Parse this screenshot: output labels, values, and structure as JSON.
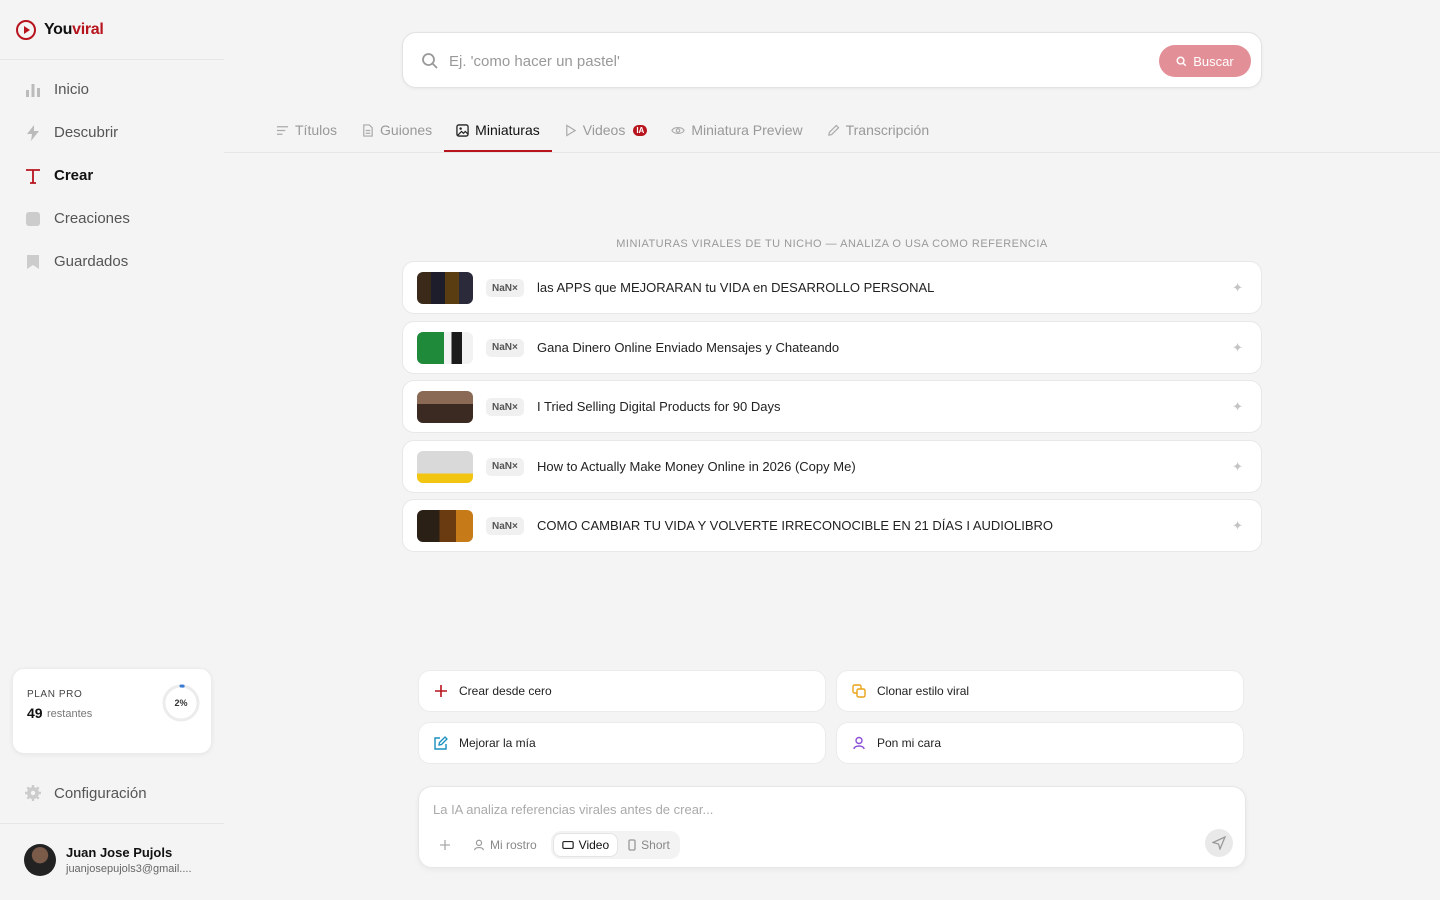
{
  "app": {
    "name_a": "You",
    "name_b": "viral"
  },
  "sidebar": {
    "items": [
      {
        "label": "Inicio",
        "icon": "bar-chart-icon"
      },
      {
        "label": "Descubrir",
        "icon": "lightning-icon"
      },
      {
        "label": "Crear",
        "icon": "text-cursor-icon"
      },
      {
        "label": "Creaciones",
        "icon": "folder-icon"
      },
      {
        "label": "Guardados",
        "icon": "bookmark-icon"
      }
    ],
    "active_index": 2,
    "plan": {
      "label": "PLAN PRO",
      "count": "49",
      "count_label": "restantes",
      "percent_text": "2%",
      "percent": 2
    },
    "config_label": "Configuración",
    "user": {
      "name": "Juan Jose Pujols",
      "email": "juanjosepujols3@gmail...."
    }
  },
  "search": {
    "placeholder": "Ej. 'como hacer un pastel'",
    "button": "Buscar"
  },
  "tabs": [
    {
      "label": "Títulos",
      "icon": "lines-icon"
    },
    {
      "label": "Guiones",
      "icon": "document-icon"
    },
    {
      "label": "Miniaturas",
      "icon": "image-icon"
    },
    {
      "label": "Videos",
      "icon": "play-icon",
      "badge": "IA"
    },
    {
      "label": "Miniatura Preview",
      "icon": "eye-icon"
    },
    {
      "label": "Transcripción",
      "icon": "pencil-icon"
    }
  ],
  "active_tab": 2,
  "section": {
    "title": "MINIATURAS VIRALES DE TU NICHO — ANALIZA O USA COMO REFERENCIA",
    "items": [
      {
        "tag": "NaN×",
        "title": "las APPS que MEJORARAN tu VIDA en DESARROLLO PERSONAL"
      },
      {
        "tag": "NaN×",
        "title": "Gana Dinero Online Enviado Mensajes y Chateando"
      },
      {
        "tag": "NaN×",
        "title": "I Tried Selling Digital Products for 90 Days"
      },
      {
        "tag": "NaN×",
        "title": "How to Actually Make Money Online in 2026 (Copy Me)"
      },
      {
        "tag": "NaN×",
        "title": "COMO CAMBIAR TU VIDA Y VOLVERTE IRRECONOCIBLE EN 21 DÍAS I AUDIOLIBRO"
      }
    ]
  },
  "actions": [
    {
      "label": "Crear desde cero",
      "icon": "plus-icon",
      "color": "#b8141e"
    },
    {
      "label": "Clonar estilo viral",
      "icon": "copy-icon",
      "color": "#e8a317"
    },
    {
      "label": "Mejorar la mía",
      "icon": "edit-icon",
      "color": "#1a8fbf"
    },
    {
      "label": "Pon mi cara",
      "icon": "person-icon",
      "color": "#8a4fd6"
    }
  ],
  "composer": {
    "placeholder": "La IA analiza referencias virales antes de crear...",
    "face_label": "Mi rostro",
    "video_label": "Video",
    "short_label": "Short"
  },
  "colors": {
    "brand": "#b8141e",
    "search_button": "#e38f97"
  }
}
